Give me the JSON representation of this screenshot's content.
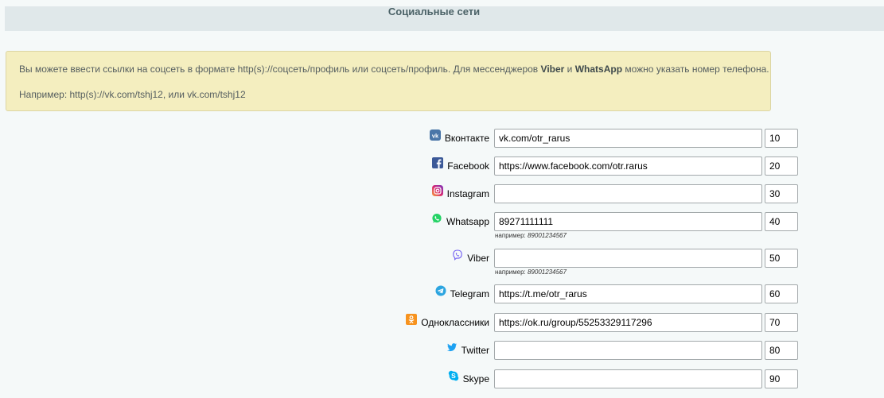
{
  "section": {
    "title": "Социальные сети"
  },
  "notice": {
    "line1_part1": "Вы можете ввести ссылки на соцсеть в формате http(s)://соцсеть/профиль или соцсеть/профиль. Для мессенджеров ",
    "viber": "Viber",
    "line1_and": " и ",
    "whatsapp": "WhatsApp",
    "line1_part2": " можно указать номер телефона.",
    "line2": "Например: http(s)://vk.com/tshj12, или vk.com/tshj12"
  },
  "rows": [
    {
      "label": "Вконтакте",
      "icon": "vk-icon",
      "icon_color": "#4a76a8",
      "value": "vk.com/otr_rarus",
      "sort": "10"
    },
    {
      "label": "Facebook",
      "icon": "facebook-icon",
      "icon_color": "#3b5998",
      "value": "https://www.facebook.com/otr.rarus",
      "sort": "20"
    },
    {
      "label": "Instagram",
      "icon": "instagram-icon",
      "icon_color": "#c13584",
      "value": "",
      "sort": "30"
    },
    {
      "label": "Whatsapp",
      "icon": "whatsapp-icon",
      "icon_color": "#25d366",
      "value": "89271111111",
      "sort": "40",
      "hint_prefix": "например:",
      "hint_value": "89001234567"
    },
    {
      "label": "Viber",
      "icon": "viber-icon",
      "icon_color": "#7360f2",
      "value": "",
      "sort": "50",
      "hint_prefix": "например:",
      "hint_value": "89001234567"
    },
    {
      "label": "Telegram",
      "icon": "telegram-icon",
      "icon_color": "#2ca5e0",
      "value": "https://t.me/otr_rarus",
      "sort": "60"
    },
    {
      "label": "Одноклассники",
      "icon": "odnoklassniki-icon",
      "icon_color": "#f7931e",
      "value": "https://ok.ru/group/55253329117296",
      "sort": "70"
    },
    {
      "label": "Twitter",
      "icon": "twitter-icon",
      "icon_color": "#1da1f2",
      "value": "",
      "sort": "80"
    },
    {
      "label": "Skype",
      "icon": "skype-icon",
      "icon_color": "#00aff0",
      "value": "",
      "sort": "90"
    }
  ]
}
